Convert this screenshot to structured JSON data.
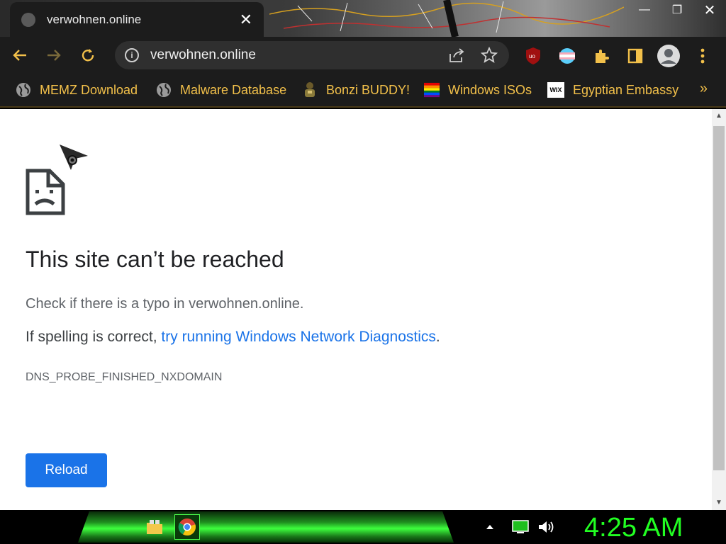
{
  "browser": {
    "tab": {
      "title": "verwohnen.online"
    },
    "window_controls": {
      "minimize": "—",
      "restore": "❐",
      "close": "✕"
    },
    "omnibox": {
      "url": "verwohnen.online"
    },
    "bookmarks": [
      {
        "label": "MEMZ Download",
        "icon": "globe-icon"
      },
      {
        "label": "Malware Database",
        "icon": "globe-icon"
      },
      {
        "label": "Bonzi BUDDY!",
        "icon": "bonzi-icon"
      },
      {
        "label": "Windows ISOs",
        "icon": "rainbow-flag-icon"
      },
      {
        "label": "Egyptian Embassy",
        "icon": "wix-icon"
      }
    ],
    "bookmarks_more": "»",
    "wix_badge": "WIX"
  },
  "error_page": {
    "title": "This site can’t be reached",
    "description": "Check if there is a typo in verwohnen.online.",
    "hint_prefix": "If spelling is correct, ",
    "hint_link": "try running Windows Network Diagnostics",
    "hint_suffix": ".",
    "error_code": "DNS_PROBE_FINISHED_NXDOMAIN",
    "reload_label": "Reload"
  },
  "taskbar": {
    "clock": "4:25 AM"
  },
  "colors": {
    "bookmark_text": "#f2c04a",
    "link": "#1a73e8",
    "clock": "#22ff22"
  }
}
